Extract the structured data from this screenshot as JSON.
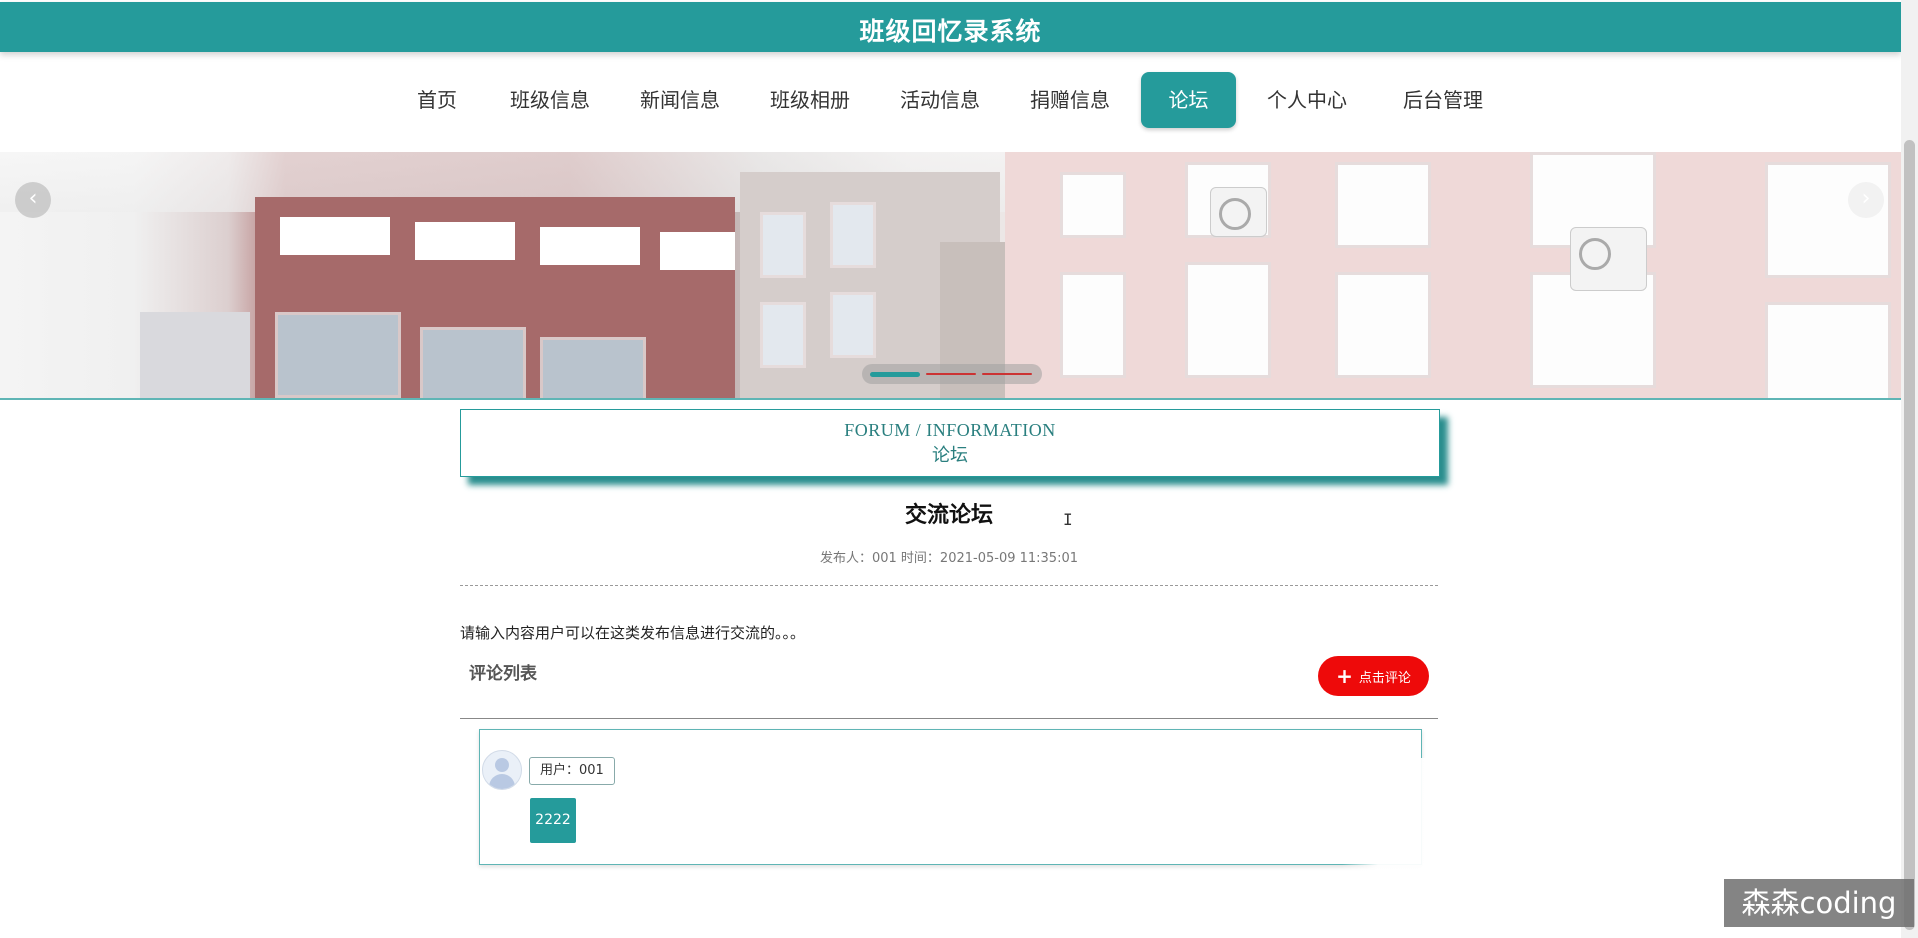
{
  "header": {
    "title": "班级回忆录系统"
  },
  "nav": {
    "items": [
      {
        "label": "首页"
      },
      {
        "label": "班级信息"
      },
      {
        "label": "新闻信息"
      },
      {
        "label": "班级相册"
      },
      {
        "label": "活动信息"
      },
      {
        "label": "捐赠信息"
      },
      {
        "label": "论坛",
        "active": true
      },
      {
        "label": "个人中心"
      },
      {
        "label": "后台管理"
      }
    ]
  },
  "carousel": {
    "prev_icon": "chevron-left-icon",
    "next_icon": "chevron-right-icon",
    "prev_glyph": "‹",
    "next_glyph": "›"
  },
  "section": {
    "title_en": "FORUM / INFORMATION",
    "title_cn": "论坛"
  },
  "post": {
    "title": "交流论坛",
    "meta": "发布人：001 时间：2021-05-09 11:35:01",
    "body": "请输入内容用户可以在这类发布信息进行交流的。。。"
  },
  "comments": {
    "heading": "评论列表",
    "add_button_label": "点击评论",
    "add_button_icon": "+",
    "items": [
      {
        "user": "用户：001",
        "content": "2222"
      }
    ]
  },
  "watermark": "森森coding",
  "colors": {
    "primary": "#259b9b",
    "danger": "#ee0a0a"
  }
}
